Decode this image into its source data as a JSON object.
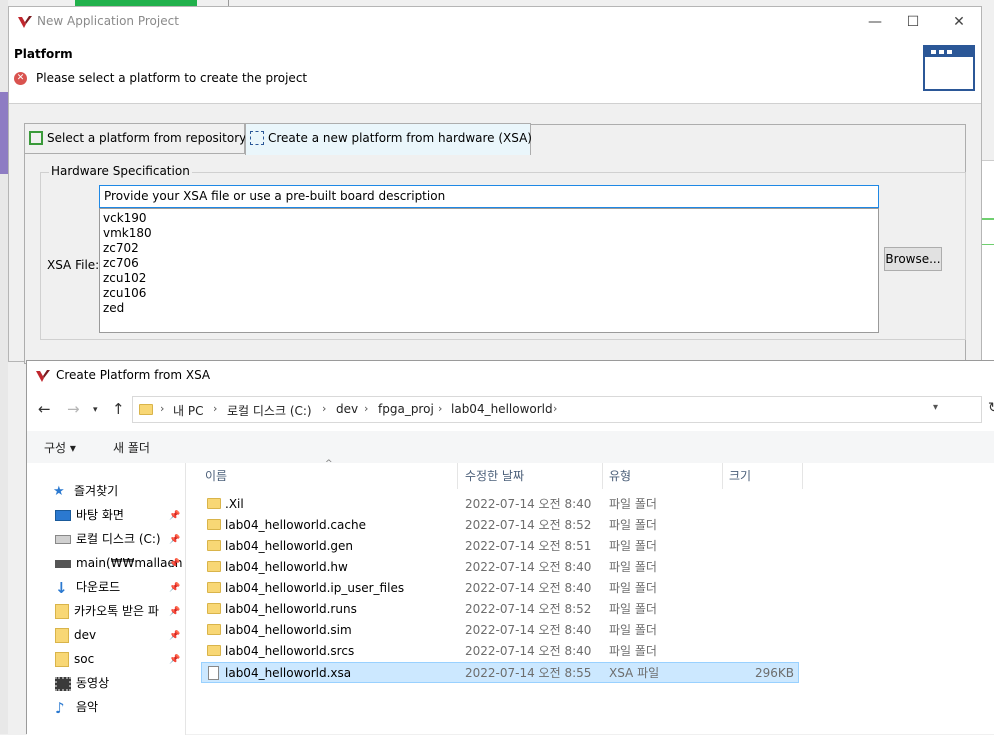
{
  "wizard": {
    "title": "New Application Project",
    "header_title": "Platform",
    "header_message": "Please select a platform to create the project",
    "tabs": [
      {
        "label": "Select a platform from repository"
      },
      {
        "label": "Create a new platform from hardware (XSA)"
      }
    ],
    "hardware_group_label": "Hardware Specification",
    "xsa_label": "XSA File:",
    "xsa_placeholder": "Provide your XSA file or use a pre-built board description",
    "boards": [
      "vck190",
      "vmk180",
      "zc702",
      "zc706",
      "zcu102",
      "zcu106",
      "zed"
    ],
    "browse_label": "Browse..."
  },
  "dialog": {
    "title": "Create Platform from XSA",
    "breadcrumb": [
      "내 PC",
      "로컬 디스크 (C:)",
      "dev",
      "fpga_proj",
      "lab04_helloworld"
    ],
    "toolbar": {
      "organize": "구성 ▾",
      "new_folder": "새 폴더"
    },
    "nav": [
      {
        "label": "즐겨찾기",
        "icon": "star-icon"
      },
      {
        "label": "바탕 화면",
        "icon": "desktop-icon"
      },
      {
        "label": "로컬 디스크 (C:)",
        "icon": "drive-icon"
      },
      {
        "label": "main(₩₩mallaen",
        "icon": "network-drive-icon"
      },
      {
        "label": "다운로드",
        "icon": "download-icon"
      },
      {
        "label": "카카오톡 받은 파",
        "icon": "folder-icon"
      },
      {
        "label": "dev",
        "icon": "folder-icon"
      },
      {
        "label": "soc",
        "icon": "folder-icon"
      },
      {
        "label": "동영상",
        "icon": "video-icon"
      },
      {
        "label": "음악",
        "icon": "music-icon"
      }
    ],
    "columns": {
      "name": "이름",
      "date": "수정한 날짜",
      "type": "유형",
      "size": "크기"
    },
    "files": [
      {
        "name": ".Xil",
        "date": "2022-07-14 오전 8:40",
        "type": "파일 폴더",
        "size": ""
      },
      {
        "name": "lab04_helloworld.cache",
        "date": "2022-07-14 오전 8:52",
        "type": "파일 폴더",
        "size": ""
      },
      {
        "name": "lab04_helloworld.gen",
        "date": "2022-07-14 오전 8:51",
        "type": "파일 폴더",
        "size": ""
      },
      {
        "name": "lab04_helloworld.hw",
        "date": "2022-07-14 오전 8:40",
        "type": "파일 폴더",
        "size": ""
      },
      {
        "name": "lab04_helloworld.ip_user_files",
        "date": "2022-07-14 오전 8:40",
        "type": "파일 폴더",
        "size": ""
      },
      {
        "name": "lab04_helloworld.runs",
        "date": "2022-07-14 오전 8:52",
        "type": "파일 폴더",
        "size": ""
      },
      {
        "name": "lab04_helloworld.sim",
        "date": "2022-07-14 오전 8:40",
        "type": "파일 폴더",
        "size": ""
      },
      {
        "name": "lab04_helloworld.srcs",
        "date": "2022-07-14 오전 8:40",
        "type": "파일 폴더",
        "size": ""
      },
      {
        "name": "lab04_helloworld.xsa",
        "date": "2022-07-14 오전 8:55",
        "type": "XSA 파일",
        "size": "296KB"
      }
    ]
  },
  "colors": {
    "accent": "#1e88e5",
    "selection": "#cce8ff",
    "error": "#d9534f",
    "folder": "#f8d775"
  }
}
